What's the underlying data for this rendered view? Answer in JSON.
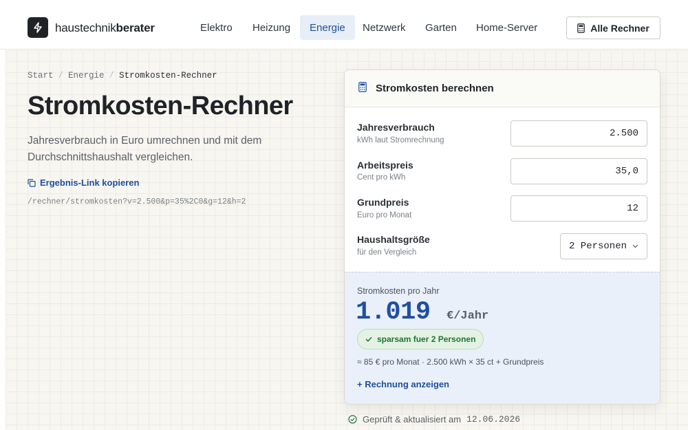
{
  "brand": {
    "name_regular": "haustechnik",
    "name_bold": "berater",
    "logo_icon": "lightning-icon"
  },
  "nav": {
    "items": [
      "Elektro",
      "Heizung",
      "Energie",
      "Netzwerk",
      "Garten",
      "Home-Server"
    ],
    "active": "Energie",
    "all_calculators": "Alle Rechner",
    "all_calculators_icon": "calculator-icon"
  },
  "breadcrumb": {
    "items": [
      "Start",
      "Energie"
    ],
    "current": "Stromkosten-Rechner",
    "separator": "/"
  },
  "page": {
    "title": "Stromkosten-Rechner",
    "lead": "Jahresverbrauch in Euro umrechnen und mit dem Durchschnittshaushalt vergleichen.",
    "copy_link": "Ergebnis-Link kopieren",
    "copy_icon": "copy-icon",
    "url": "/rechner/stromkosten?v=2.500&p=35%2C0&g=12&h=2"
  },
  "calculator": {
    "title": "Stromkosten berechnen",
    "fields": [
      {
        "label": "Jahresverbrauch",
        "sub": "kWh laut Stromrechnung",
        "value": "2.500"
      },
      {
        "label": "Arbeitspreis",
        "sub": "Cent pro kWh",
        "value": "35,0"
      },
      {
        "label": "Grundpreis",
        "sub": "Euro pro Monat",
        "value": "12"
      }
    ],
    "household": {
      "label": "Haushaltsgröße",
      "sub": "für den Vergleich",
      "value": "2 Personen"
    }
  },
  "result": {
    "label": "Stromkosten pro Jahr",
    "value": "1.019",
    "unit": "€/Jahr",
    "badge": "sparsam fuer 2 Personen",
    "formula": "≈ 85 € pro Monat · 2.500 kWh × 35 ct + Grundpreis",
    "toggle": "+ Rechnung anzeigen"
  },
  "verified": {
    "text": "Geprüft & aktualisiert am",
    "date": "12.06.2026"
  },
  "colors": {
    "accent": "#1f4fa0",
    "success": "#21733a",
    "background": "#f7f6f1"
  }
}
